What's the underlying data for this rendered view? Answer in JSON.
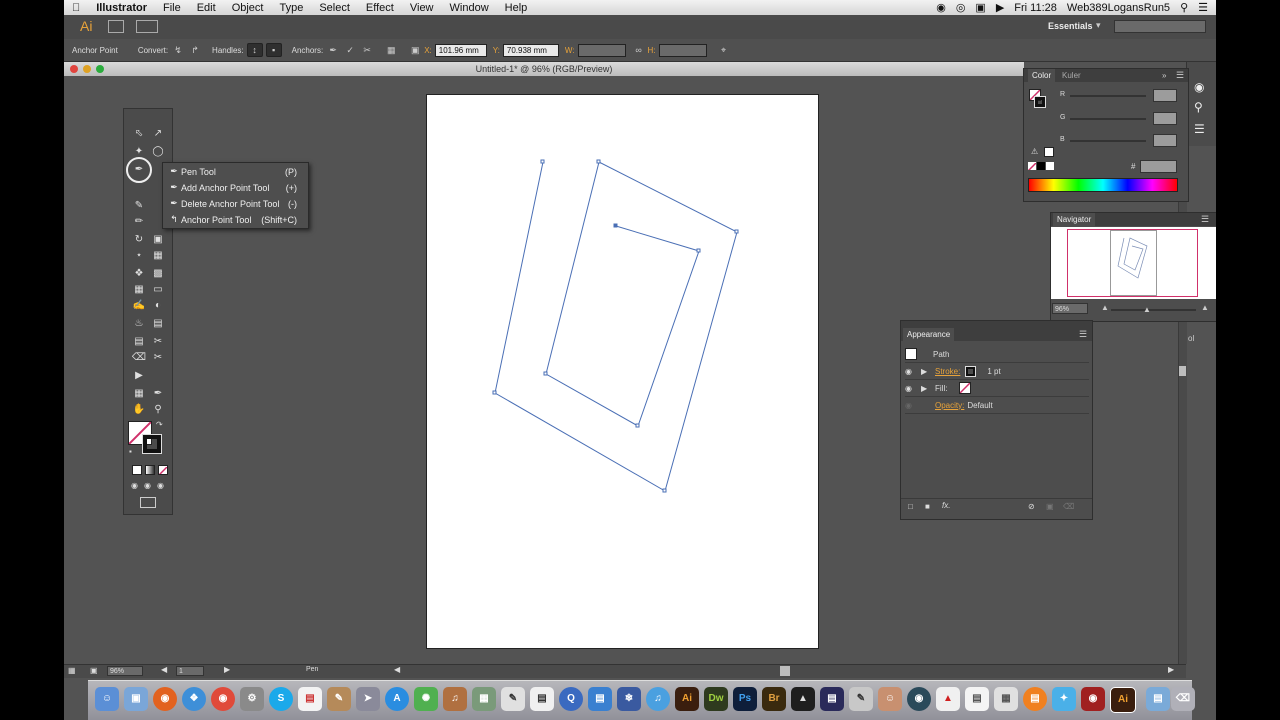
{
  "menubar": {
    "app_name": "Illustrator",
    "items": [
      "File",
      "Edit",
      "Object",
      "Type",
      "Select",
      "Effect",
      "View",
      "Window",
      "Help"
    ],
    "clock": "Fri 11:28",
    "user": "Web389LogansRun5"
  },
  "appbar": {
    "logo": "Ai",
    "workspace": "Essentials"
  },
  "control": {
    "tool_label": "Anchor Point",
    "convert_label": "Convert:",
    "handles_label": "Handles:",
    "anchors_label": "Anchors:",
    "x_label": "X:",
    "x_value": "101.96 mm",
    "y_label": "Y:",
    "y_value": "70.938 mm",
    "w_label": "W:",
    "h_label": "H:"
  },
  "document": {
    "title": "Untitled-1* @ 96% (RGB/Preview)"
  },
  "flyout": {
    "items": [
      {
        "label": "Pen Tool",
        "shortcut": "(P)"
      },
      {
        "label": "Add Anchor Point Tool",
        "shortcut": "(+)"
      },
      {
        "label": "Delete Anchor Point Tool",
        "shortcut": "(-)"
      },
      {
        "label": "Anchor Point Tool",
        "shortcut": "(Shift+C)"
      }
    ]
  },
  "color_panel": {
    "tab_color": "Color",
    "tab_kuler": "Kuler",
    "r_label": "R",
    "g_label": "G",
    "b_label": "B",
    "hash": "#"
  },
  "navigator": {
    "title": "Navigator",
    "zoom": "96%"
  },
  "appearance": {
    "title": "Appearance",
    "object": "Path",
    "stroke_label": "Stroke:",
    "stroke_weight": "1 pt",
    "fill_label": "Fill:",
    "opacity_label": "Opacity:",
    "opacity_value": "Default",
    "fx_label": "fx."
  },
  "status": {
    "zoom": "96%",
    "artboard": "1",
    "tool": "Pen"
  },
  "side_fragment": "ol",
  "colors": {
    "path_stroke": "#4a6fb5",
    "highlight": "#e8a33a",
    "navigator_frame": "#d0306a"
  },
  "dock": {
    "apps": [
      "Finder",
      "Preview",
      "Firefox",
      "Safari",
      "Chrome",
      "Utility",
      "Skype",
      "Calendar",
      "Pages",
      "Rocket",
      "App Store",
      "Picasa",
      "Guitar",
      "Photo",
      "Script",
      "Notes",
      "Q",
      "Folder",
      "Snowflake",
      "iTunes",
      "Ai",
      "Dw",
      "Ps",
      "Br",
      "Acrobat",
      "Media",
      "Brush",
      "Face",
      "Drive",
      "Adobe",
      "Doc",
      "Photos",
      "Books",
      "Twitter",
      "Photo Booth",
      "Ai2",
      "Folder2",
      "Trash"
    ]
  }
}
